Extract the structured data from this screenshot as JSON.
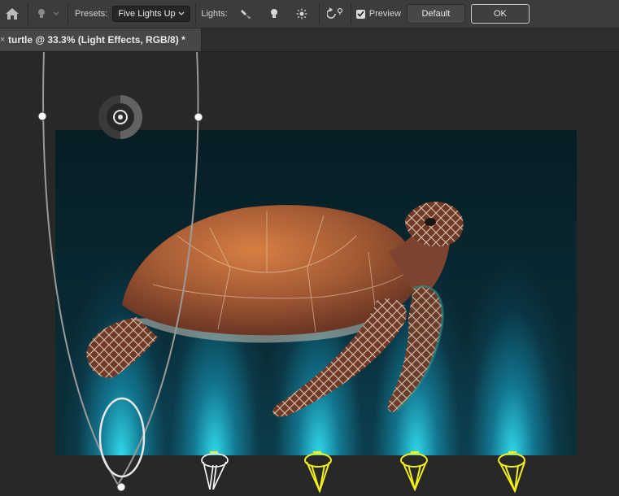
{
  "options_bar": {
    "home_icon": "home-icon",
    "light_type_icon": "light-bulb-icon",
    "presets_label": "Presets:",
    "presets_value": "Five Lights Up",
    "lights_label": "Lights:",
    "light_buttons": [
      "spot-light-icon",
      "point-light-icon",
      "infinite-light-icon"
    ],
    "reset_icon": "reset-light-icon",
    "preview_label": "Preview",
    "preview_checked": true,
    "default_label": "Default",
    "ok_label": "OK"
  },
  "document_tab": {
    "title": "turtle @ 33.3% (Light Effects, RGB/8) *"
  },
  "canvas": {
    "photo_subject": "sea turtle",
    "light_count": 5,
    "selected_light_index": 0,
    "beam_color": "#2fd8f2",
    "spot_widget_color": "#f2ef19",
    "selected_widget_color": "#ffffff"
  }
}
